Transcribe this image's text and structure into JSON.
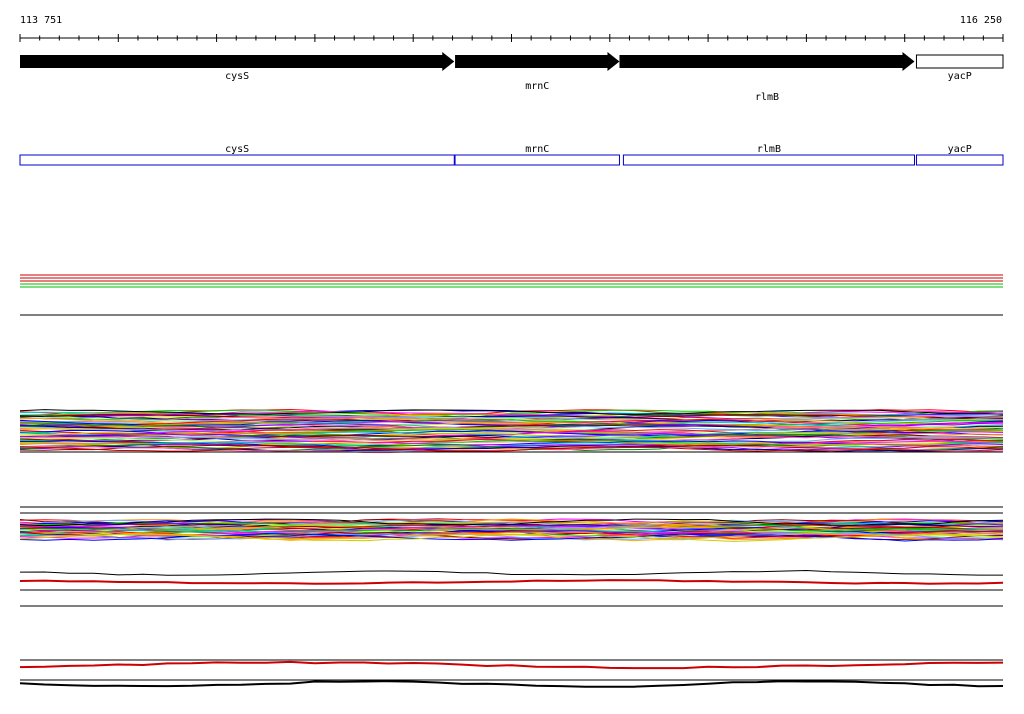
{
  "ruler": {
    "start_label": "113 751",
    "end_label": "116 250",
    "start": 113751,
    "end": 116250
  },
  "colors": {
    "gene_fill": "#000000",
    "partial_gene_fill": "#ffffff",
    "transcript_box": "#0000cc",
    "line_red": "#cc0000",
    "line_green": "#00bb00",
    "line_black": "#000000"
  },
  "chart_data": {
    "type": "line",
    "title": "",
    "xlabel": "",
    "ylabel": "",
    "x_range": [
      113751,
      116250
    ],
    "genes": [
      {
        "name": "cysS",
        "start": 113751,
        "end": 114855,
        "strand": "+"
      },
      {
        "name": "mrnC",
        "start": 114857,
        "end": 115275,
        "strand": "+"
      },
      {
        "name": "rlmB",
        "start": 115275,
        "end": 116025,
        "strand": "+"
      },
      {
        "name": "yacP",
        "start": 116030,
        "end": 116250,
        "strand": "+",
        "partial": true
      }
    ],
    "transcripts": [
      {
        "name": "cysS",
        "start": 113751,
        "end": 114855
      },
      {
        "name": "mrnC",
        "start": 114857,
        "end": 115275
      },
      {
        "name": "rlmB",
        "start": 115285,
        "end": 116025
      },
      {
        "name": "yacP",
        "start": 116030,
        "end": 116250
      }
    ]
  }
}
